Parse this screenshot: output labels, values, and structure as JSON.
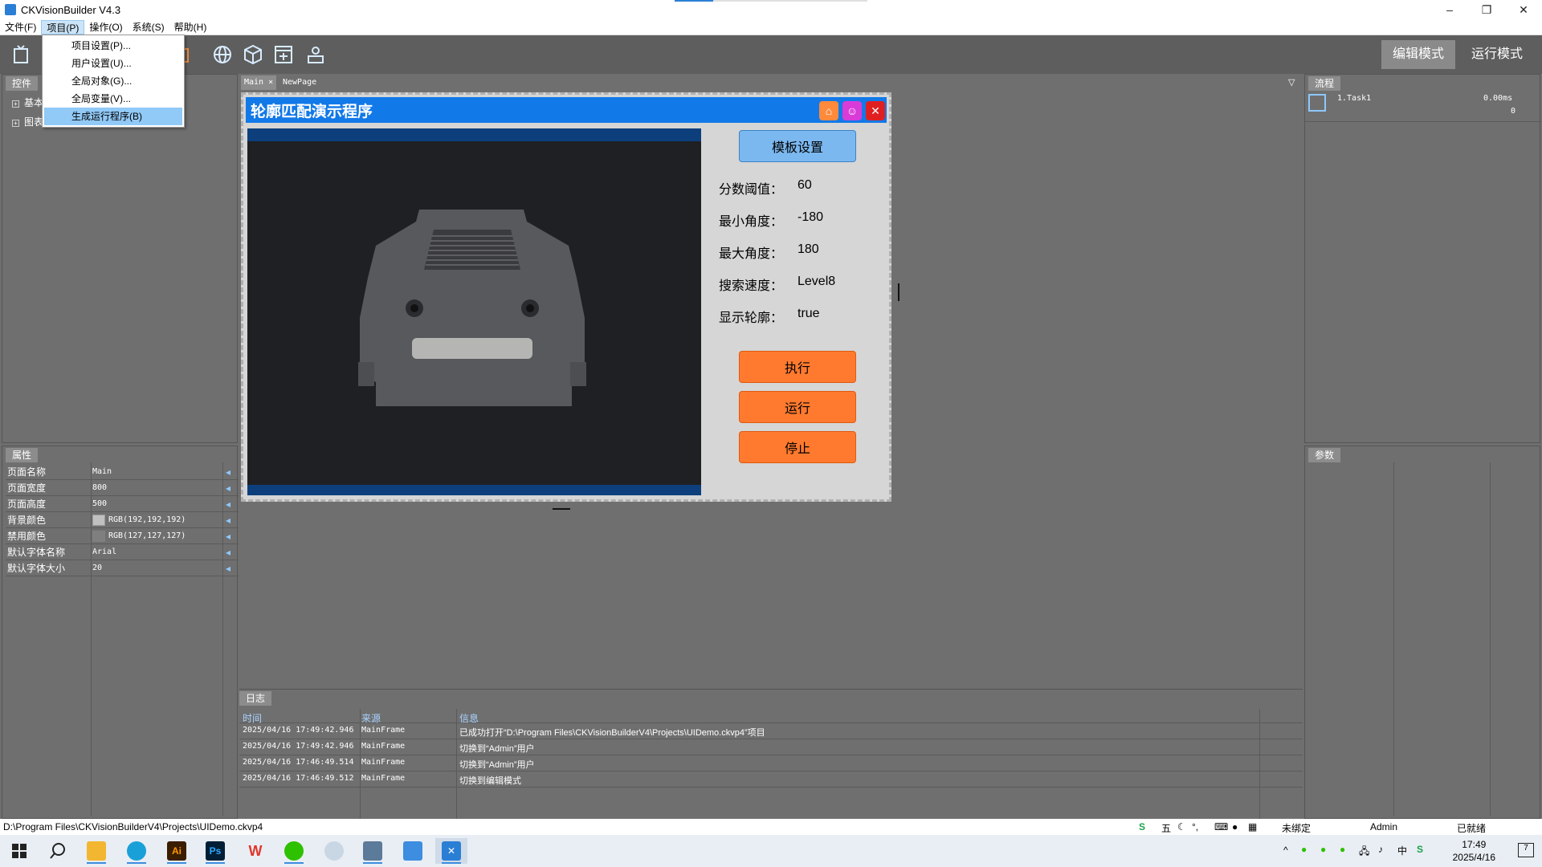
{
  "window": {
    "title": "CKVisionBuilder V4.3",
    "minimize": "–",
    "restore": "❐",
    "close": "✕"
  },
  "menu": [
    "文件(F)",
    "项目(P)",
    "操作(O)",
    "系统(S)",
    "帮助(H)"
  ],
  "dropdown": [
    "项目设置(P)...",
    "用户设置(U)...",
    "全局对象(G)...",
    "全局变量(V)...",
    "生成运行程序(B)"
  ],
  "modes": {
    "edit": "编辑模式",
    "run": "运行模式"
  },
  "left_panel": {
    "tab": "控件",
    "tree": [
      "基本",
      "图表"
    ]
  },
  "props": {
    "tab": "属性",
    "rows": [
      {
        "k": "页面名称",
        "v": "Main"
      },
      {
        "k": "页面宽度",
        "v": "800"
      },
      {
        "k": "页面高度",
        "v": "500"
      },
      {
        "k": "背景颜色",
        "v": "RGB(192,192,192)"
      },
      {
        "k": "禁用颜色",
        "v": "RGB(127,127,127)"
      },
      {
        "k": "默认字体名称",
        "v": "Arial"
      },
      {
        "k": "默认字体大小",
        "v": "20"
      }
    ],
    "swatch_color": "#c0c0c0"
  },
  "page_tabs": [
    "Main",
    "NewPage"
  ],
  "dialog": {
    "title": "轮廓匹配演示程序",
    "template_button": "模板设置",
    "fields": [
      {
        "label": "分数阈值：",
        "value": "60"
      },
      {
        "label": "最小角度：",
        "value": "-180"
      },
      {
        "label": "最大角度：",
        "value": "180"
      },
      {
        "label": "搜索速度：",
        "value": "Level8"
      },
      {
        "label": "显示轮廓：",
        "value": "true"
      }
    ],
    "buttons": [
      "执行",
      "运行",
      "停止"
    ],
    "colors": {
      "title_bar": "#1279e8",
      "action": "#ff7a2e",
      "template": "#7bb8f0"
    }
  },
  "flow": {
    "tab": "流程",
    "task": "1.Task1",
    "time": "0.00ms",
    "count": "0"
  },
  "params": {
    "tab": "参数"
  },
  "log": {
    "tab": "日志",
    "headers": [
      "时间",
      "来源",
      "信息"
    ],
    "rows": [
      {
        "time": "2025/04/16 17:49:42.946",
        "source": "MainFrame",
        "info": "已成功打开“D:\\Program Files\\CKVisionBuilderV4\\Projects\\UIDemo.ckvp4”项目"
      },
      {
        "time": "2025/04/16 17:49:42.946",
        "source": "MainFrame",
        "info": "切换到“Admin”用户"
      },
      {
        "time": "2025/04/16 17:46:49.514",
        "source": "MainFrame",
        "info": "切换到“Admin”用户"
      },
      {
        "time": "2025/04/16 17:46:49.512",
        "source": "MainFrame",
        "info": "切换到编辑模式"
      }
    ]
  },
  "status": {
    "path": "D:\\Program Files\\CKVisionBuilderV4\\Projects\\UIDemo.ckvp4",
    "bind": "未绑定",
    "user": "Admin",
    "state": "已就绪",
    "ime": "五"
  },
  "taskbar": {
    "time": "17:49",
    "date": "2025/4/16",
    "notif": "7"
  }
}
